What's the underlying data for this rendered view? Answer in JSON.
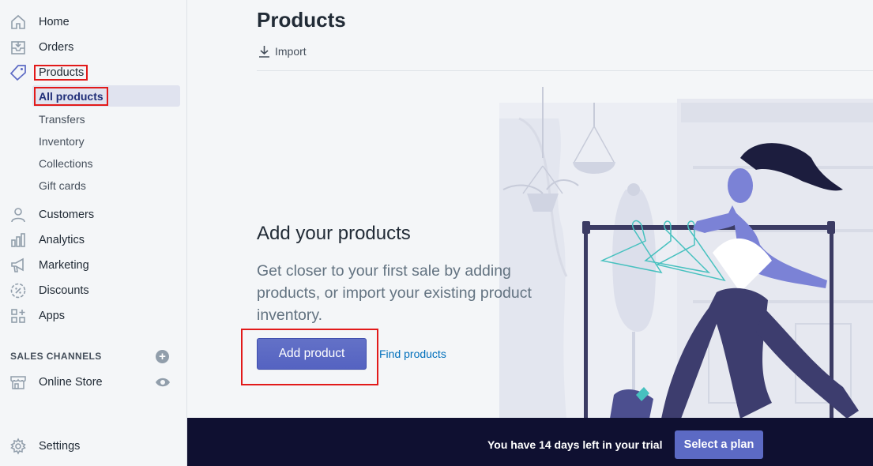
{
  "sidebar": {
    "items": [
      {
        "label": "Home",
        "icon": "home-icon"
      },
      {
        "label": "Orders",
        "icon": "orders-icon"
      },
      {
        "label": "Products",
        "icon": "tag-icon"
      },
      {
        "label": "Customers",
        "icon": "customer-icon"
      },
      {
        "label": "Analytics",
        "icon": "analytics-icon"
      },
      {
        "label": "Marketing",
        "icon": "megaphone-icon"
      },
      {
        "label": "Discounts",
        "icon": "discount-icon"
      },
      {
        "label": "Apps",
        "icon": "apps-icon"
      }
    ],
    "product_subitems": [
      {
        "label": "All products",
        "active": true
      },
      {
        "label": "Transfers"
      },
      {
        "label": "Inventory"
      },
      {
        "label": "Collections"
      },
      {
        "label": "Gift cards"
      }
    ],
    "sales_channels_title": "SALES CHANNELS",
    "online_store": "Online Store",
    "settings": "Settings"
  },
  "main": {
    "title": "Products",
    "import_label": "Import",
    "empty_state": {
      "heading": "Add your products",
      "body": "Get closer to your first sale by adding products, or import your existing product inventory.",
      "primary_action": "Add product",
      "secondary_action": "Find products"
    }
  },
  "trial_bar": {
    "message": "You have 14 days left in your trial",
    "button": "Select a plan"
  },
  "colors": {
    "accent": "#5c6ac4",
    "trial_bar": "#0f1031",
    "highlight_box": "#e21a1a",
    "link": "#006fbb"
  }
}
